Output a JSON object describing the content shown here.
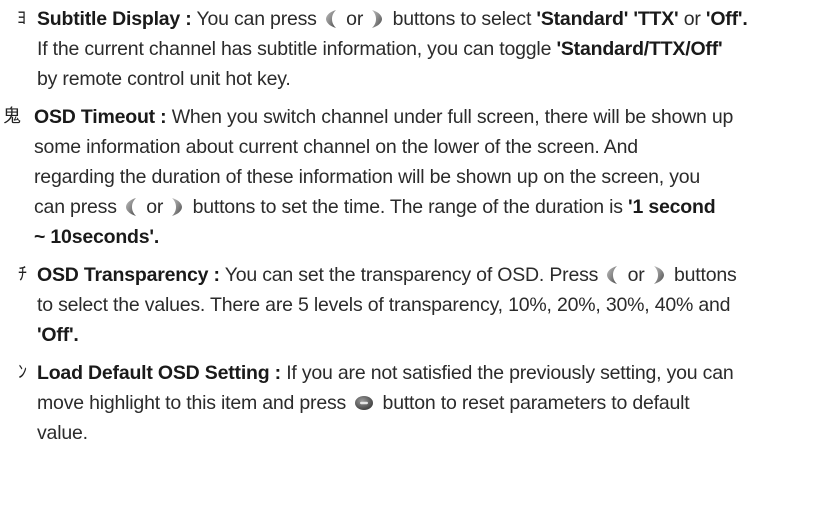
{
  "items": [
    {
      "bullet": "ﾖ",
      "term": "Subtitle Display :",
      "lines": [
        [
          "You can press",
          "or",
          "buttons to select",
          "'Standard' 'TTX'",
          "or",
          "'Off'."
        ],
        [
          "If the current channel has subtitle information, you can toggle",
          "'Standard/TTX/Off'"
        ],
        [
          "by remote control unit hot key."
        ]
      ]
    },
    {
      "bullet": "鬼",
      "term": "OSD Timeout :",
      "lines": [
        [
          "When you switch channel under full screen, there will be shown up"
        ],
        [
          "some information about current channel on the lower of the screen. And"
        ],
        [
          "regarding the duration of these information will be shown up on the screen, you"
        ],
        [
          "can press",
          "or",
          "buttons to set the time. The range of the duration is",
          "'1 second"
        ],
        [
          "~ 10seconds'."
        ]
      ]
    },
    {
      "bullet": "ﾁ",
      "term": "OSD Transparency :",
      "lines": [
        [
          "You can set the transparency of OSD. Press",
          "or",
          "buttons"
        ],
        [
          "to select the values. There are 5 levels of transparency, 10%, 20%, 30%, 40% and"
        ],
        [
          "'Off'."
        ]
      ]
    },
    {
      "bullet": "ﾝ",
      "term": "Load Default OSD Setting :",
      "lines": [
        [
          "If you are not satisfied the previously setting, you can"
        ],
        [
          "move highlight to this item and press",
          "button to reset parameters to default"
        ],
        [
          "value."
        ]
      ]
    }
  ]
}
